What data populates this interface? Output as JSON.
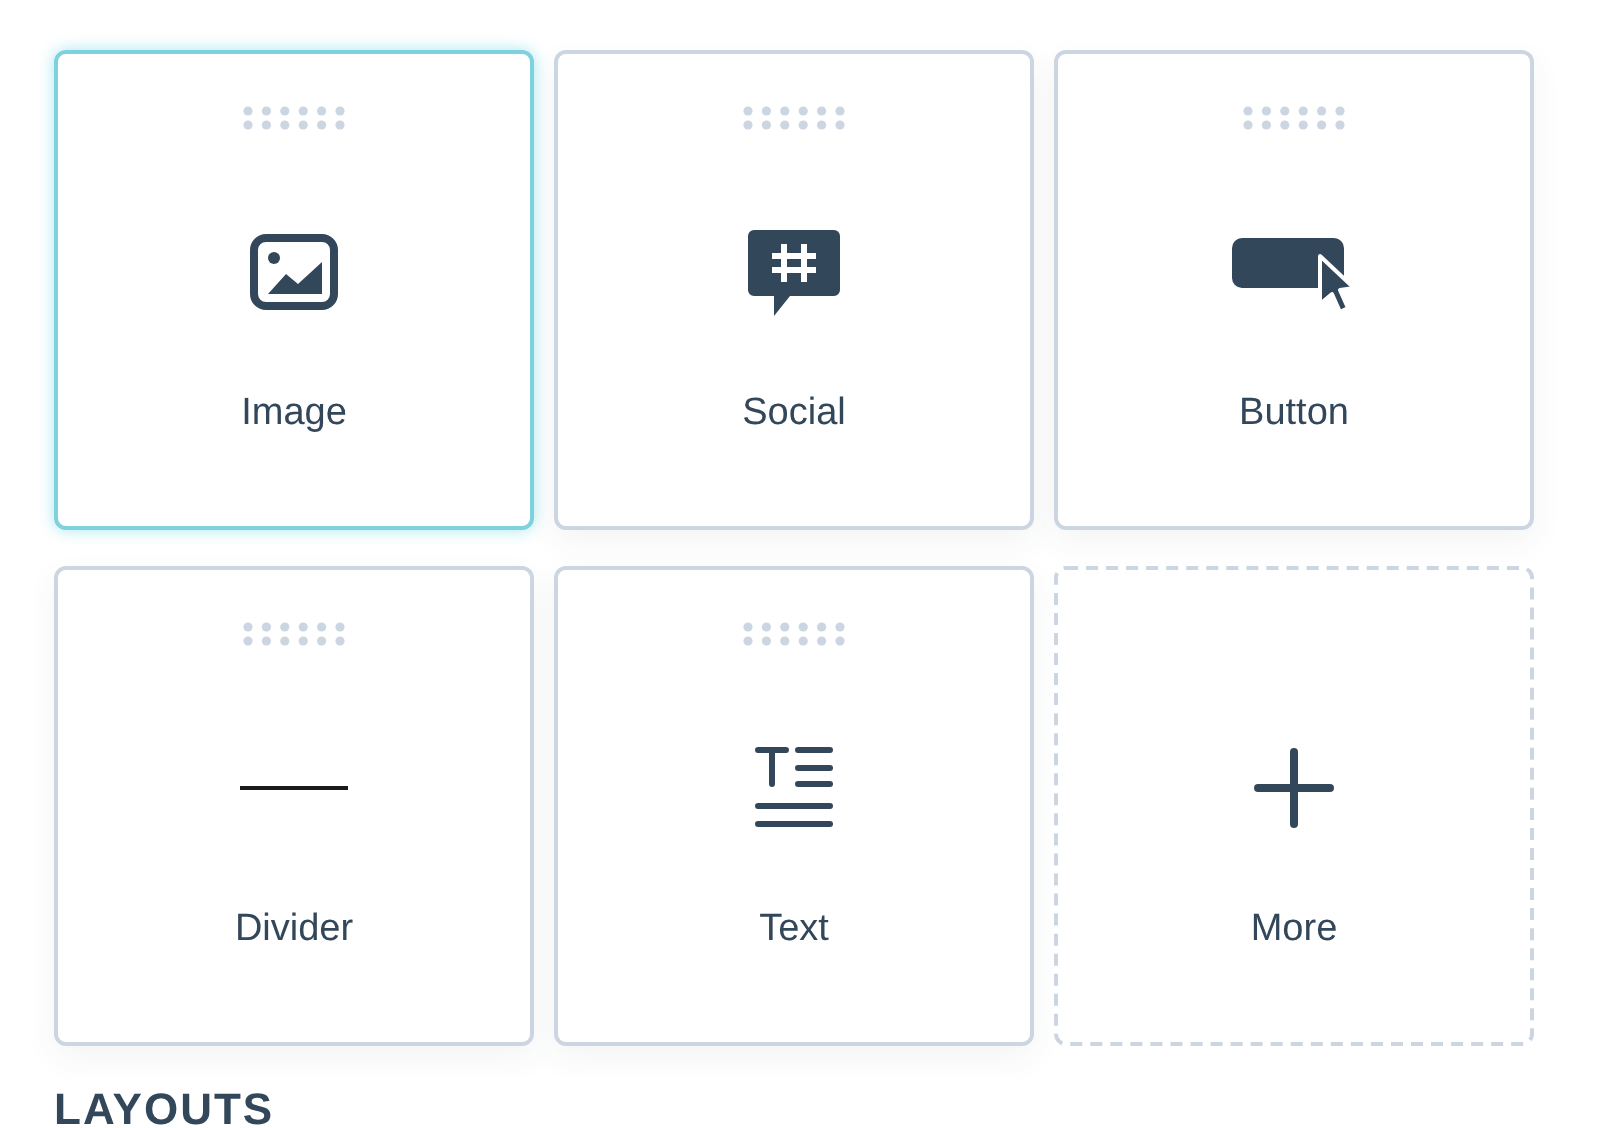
{
  "tiles": [
    {
      "label": "Image",
      "kind": "image",
      "selected": true
    },
    {
      "label": "Social",
      "kind": "social",
      "selected": false
    },
    {
      "label": "Button",
      "kind": "button",
      "selected": false
    },
    {
      "label": "Divider",
      "kind": "divider",
      "selected": false
    },
    {
      "label": "Text",
      "kind": "text",
      "selected": false
    },
    {
      "label": "More",
      "kind": "more",
      "selected": false
    }
  ],
  "section_heading": "LAYOUTS"
}
